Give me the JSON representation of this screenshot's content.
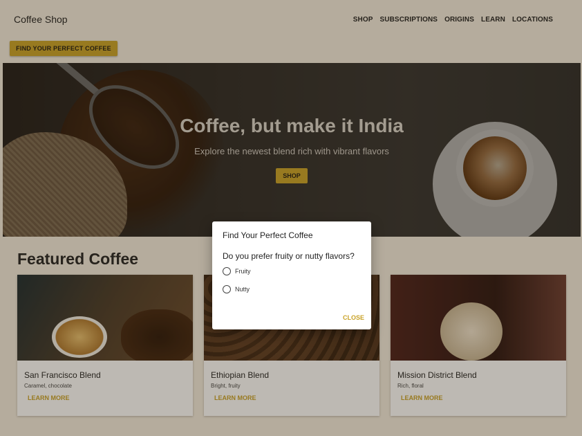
{
  "header": {
    "brand": "Coffee Shop",
    "nav": [
      "SHOP",
      "SUBSCRIPTIONS",
      "ORIGINS",
      "LEARN",
      "LOCATIONS"
    ],
    "find_button": "FIND YOUR PERFECT COFFEE"
  },
  "hero": {
    "title": "Coffee, but make it India",
    "subtitle": "Explore the newest blend rich with vibrant flavors",
    "shop_button": "SHOP"
  },
  "featured": {
    "heading": "Featured Coffee",
    "cards": [
      {
        "name": "San Francisco Blend",
        "description": "Caramel, chocolate",
        "link": "LEARN MORE"
      },
      {
        "name": "Ethiopian Blend",
        "description": "Bright, fruity",
        "link": "LEARN MORE"
      },
      {
        "name": "Mission District Blend",
        "description": "Rich, floral",
        "link": "LEARN MORE"
      }
    ]
  },
  "dialog": {
    "title": "Find Your Perfect Coffee",
    "question": "Do you prefer fruity or nutty flavors?",
    "options": [
      "Fruity",
      "Nutty"
    ],
    "close": "CLOSE"
  },
  "colors": {
    "accent": "#c9a227",
    "background": "#f3ecdf"
  }
}
